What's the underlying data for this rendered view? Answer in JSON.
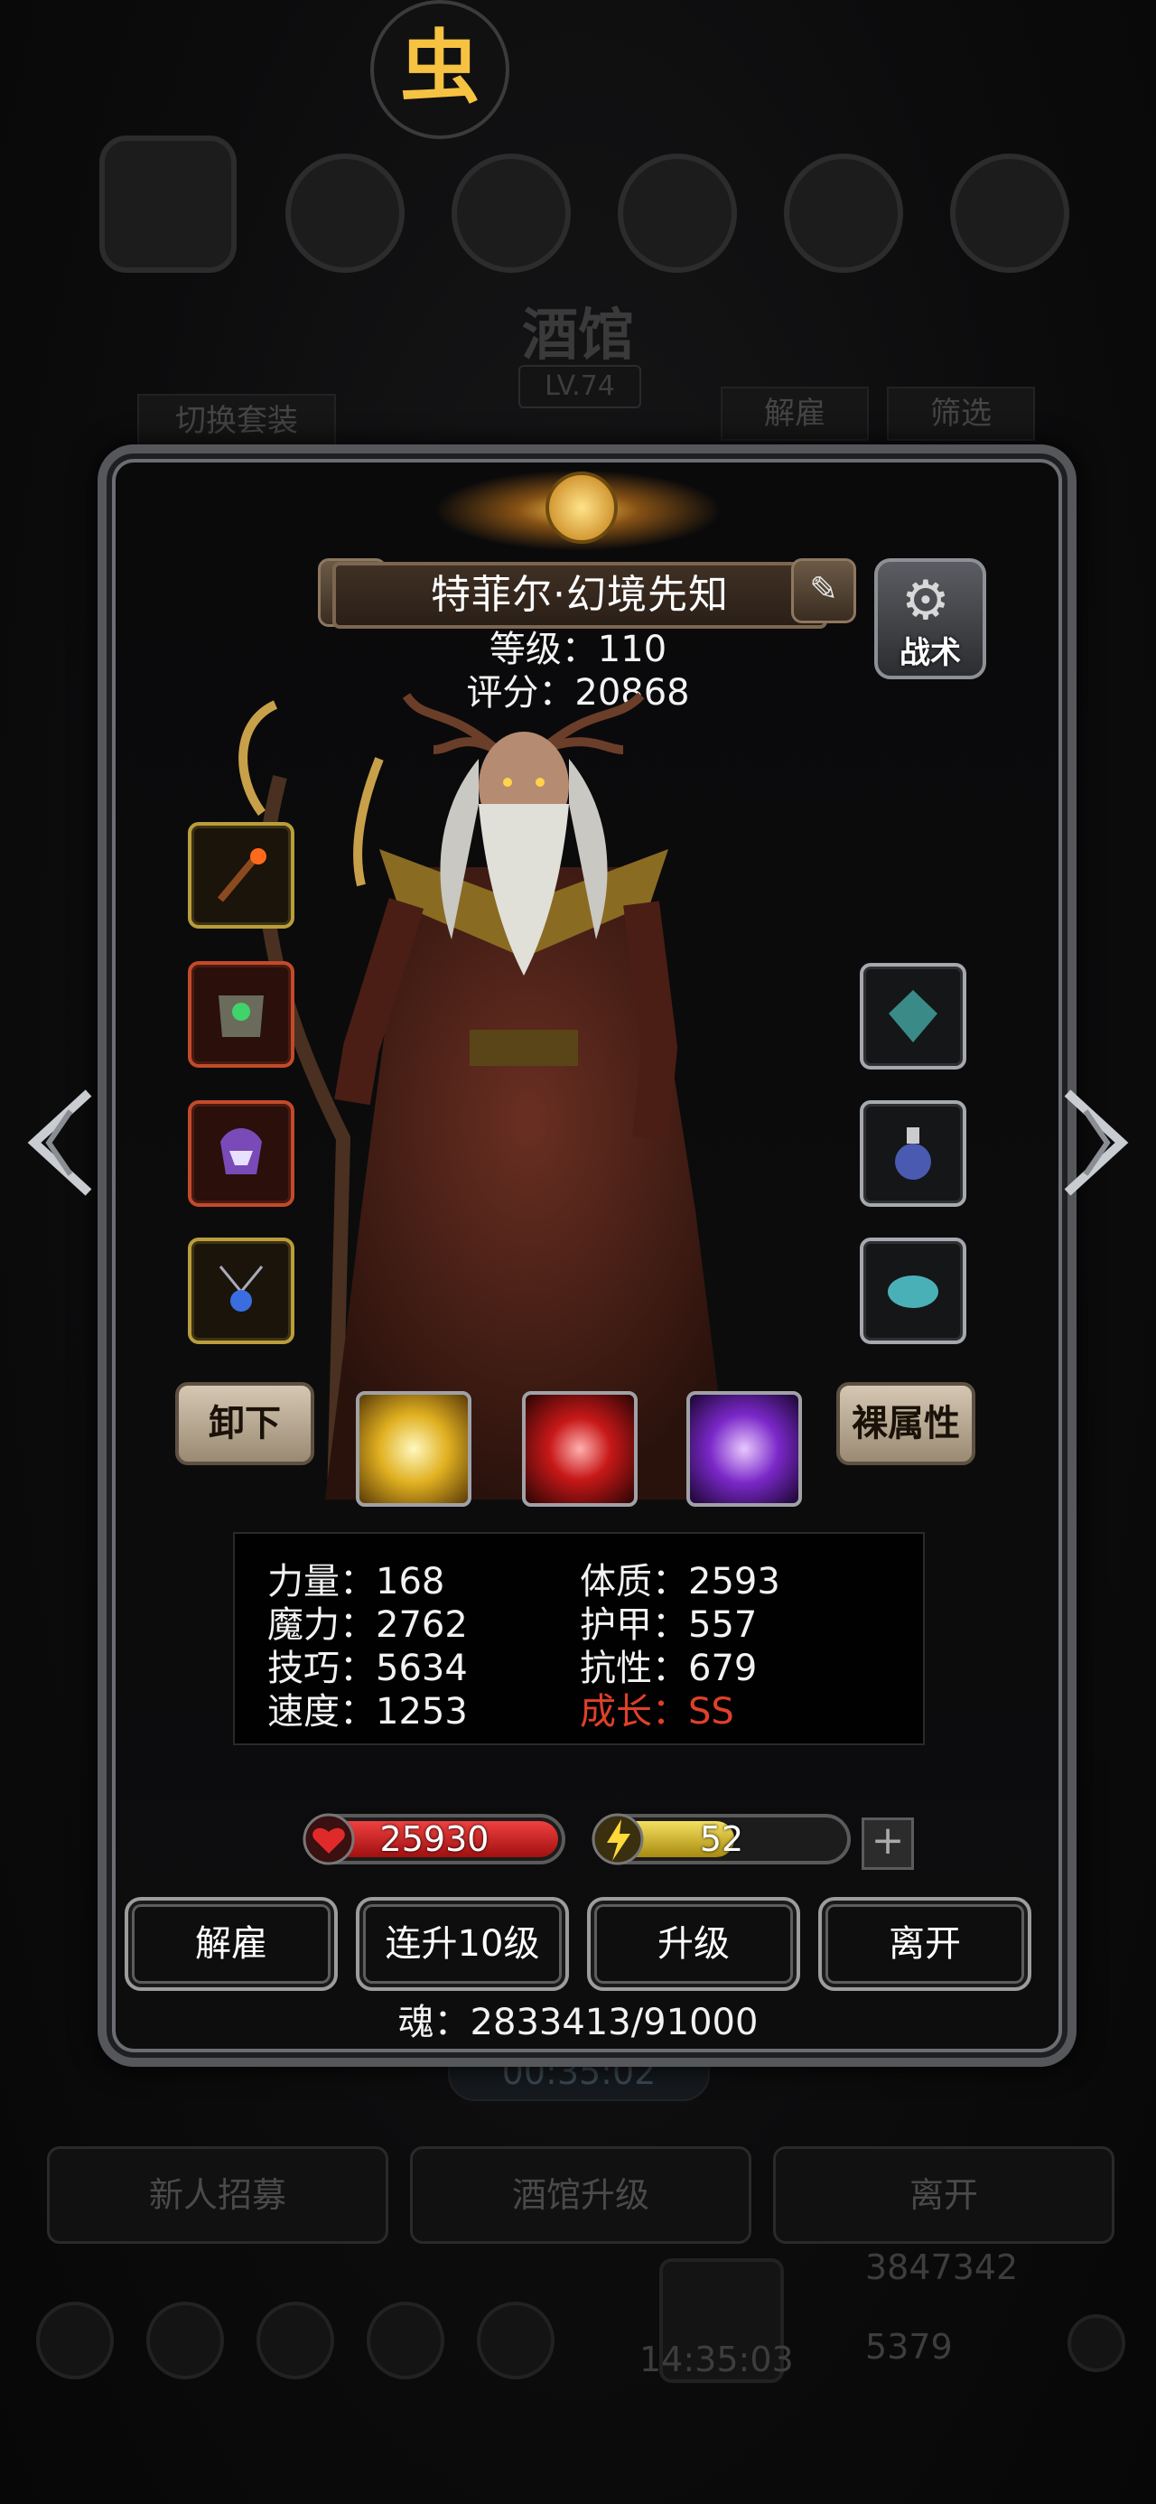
{
  "background": {
    "logo_glyph": "虫",
    "title": "酒馆",
    "level": "LV.74",
    "switch_set": "切换套装",
    "dismiss_tab": "解雇",
    "filter_tab": "筛选",
    "timer": "00:35:02",
    "recruit": "新人招募",
    "upgrade_tavern": "酒馆升级",
    "leave": "离开",
    "gold": "3847342",
    "gems": "5379",
    "clock": "14:35:03"
  },
  "hero": {
    "name": "特菲尔·幻境先知",
    "level_text": "等级：110",
    "score_text": "评分：20868",
    "tactics_label": "战术"
  },
  "buttons": {
    "unequip": "卸下",
    "bare_attr": "裸属性"
  },
  "stats": {
    "strength": "力量：168",
    "magic": "魔力：2762",
    "skill": "技巧：5634",
    "speed": "速度：1253",
    "constitution": "体质：2593",
    "armor": "护甲：557",
    "resistance": "抗性：679",
    "growth": "成长：SS"
  },
  "bars": {
    "hp": "25930",
    "energy": "52",
    "energy_fraction": 0.55,
    "add": "+"
  },
  "actions": {
    "dismiss": "解雇",
    "level10": "连升10级",
    "levelup": "升级",
    "leave": "离开"
  },
  "soul_text": "魂：2833413/91000",
  "colors": {
    "growth": "#e0402a",
    "hp_fill": "#d32525",
    "energy_fill": "#d9c12a"
  }
}
